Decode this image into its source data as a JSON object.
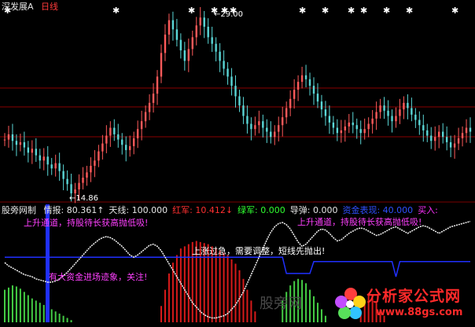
{
  "window": {
    "stock_name": "深发展A",
    "period": "日线"
  },
  "indicator": {
    "name": "股旁网制",
    "items": [
      {
        "label": "情报:",
        "value": "80.361↑",
        "color": "#e6e6e6"
      },
      {
        "label": "天线:",
        "value": "100.000",
        "color": "#e6e6e6"
      },
      {
        "label": "红军:",
        "value": "10.412↓",
        "color": "#ff3030"
      },
      {
        "label": "绿军:",
        "value": "0.000",
        "color": "#30ff30"
      },
      {
        "label": "导弹:",
        "value": "0.000",
        "color": "#e6e6e6"
      },
      {
        "label": "资金表现:",
        "value": "40.000",
        "color": "#3050ff"
      },
      {
        "label": "买入:",
        "value": "",
        "color": "#ff30ff"
      }
    ]
  },
  "annotations": {
    "high_price": "29.00",
    "low_price": "14.86",
    "text_uptrend_left": "上升通道，持股待长获高抛低吸!",
    "text_uptrend_right": "上升通道，持股待长获高抛低吸!",
    "text_overheat": "上涨过急，需要调整，短线先抛出!",
    "text_capital_in": "有大资金进场迹象，关注!"
  },
  "watermark": {
    "site_name": "分析家公式网",
    "site_url": "www.88gs.com",
    "faint_text": "股旁网"
  },
  "colors": {
    "bg": "#000000",
    "up_candle": "#ff5a5a",
    "down_candle": "#5ad7d7",
    "red_bars": "#d81a1a",
    "green_bars": "#44cc44",
    "white_line": "#f5f5f5",
    "blue_line": "#2030ff",
    "grid": "#8a0000"
  },
  "chart_data": [
    {
      "type": "line",
      "description_series": "price",
      "x": [
        0,
        1,
        2,
        3,
        4,
        5,
        6,
        7,
        8,
        9,
        10,
        11,
        12,
        13,
        14,
        15,
        16,
        17,
        18,
        19,
        20,
        21,
        22,
        23,
        24,
        25,
        26,
        27,
        28,
        29,
        30,
        31,
        32,
        33,
        34,
        35,
        36,
        37,
        38,
        39,
        40,
        41,
        42,
        43,
        44,
        45,
        46,
        47,
        48,
        49,
        50,
        51,
        52,
        53,
        54,
        55,
        56,
        57,
        58,
        59,
        60,
        61,
        62,
        63,
        64,
        65,
        66,
        67,
        68,
        69,
        70,
        71,
        72,
        73,
        74,
        75,
        76,
        77,
        78,
        79,
        80,
        81,
        82,
        83,
        84,
        85,
        86,
        87,
        88,
        89,
        90,
        91,
        92,
        93,
        94,
        95,
        96,
        97,
        98,
        99,
        100,
        101,
        102,
        103,
        104,
        105,
        106,
        107,
        108,
        109,
        110,
        111,
        112,
        113,
        114,
        115,
        116,
        117,
        118,
        119
      ],
      "series": [
        {
          "close": [
            19.2,
            19.6,
            19.1,
            18.8,
            19.0,
            18.6,
            18.2,
            18.5,
            18.0,
            17.6,
            17.9,
            17.3,
            17.0,
            17.4,
            16.8,
            16.2,
            15.8,
            15.1,
            15.4,
            15.9,
            16.3,
            16.7,
            17.2,
            17.6,
            18.3,
            18.9,
            19.5,
            20.1,
            19.6,
            19.2,
            18.8,
            18.4,
            18.7,
            19.3,
            20.0,
            20.6,
            21.3,
            22.0,
            22.7,
            24.0,
            25.8,
            27.2,
            28.3,
            27.6,
            26.8,
            26.0,
            25.2,
            26.1,
            27.0,
            27.9,
            28.5,
            27.8,
            27.0,
            26.5,
            25.9,
            25.2,
            24.6,
            24.0,
            23.3,
            22.5,
            21.8,
            21.0,
            20.4,
            20.0,
            20.3,
            20.6,
            20.1,
            19.8,
            19.4,
            19.8,
            20.3,
            20.9,
            21.6,
            22.3,
            23.0,
            23.6,
            24.1,
            23.8,
            23.3,
            22.7,
            22.1,
            21.5,
            21.0,
            20.5,
            20.1,
            19.7,
            19.9,
            20.2,
            20.5,
            20.3,
            20.0,
            19.7,
            20.0,
            20.4,
            20.8,
            21.3,
            21.8,
            21.4,
            21.0,
            20.6,
            21.0,
            21.5,
            22.0,
            21.6,
            21.1,
            20.7,
            20.3,
            19.9,
            19.5,
            19.1,
            19.4,
            19.8,
            19.4,
            19.0,
            18.6,
            18.9,
            19.3,
            19.7,
            20.1,
            19.8
          ]
        }
      ]
    },
    {
      "type": "area",
      "description_series": "indicator",
      "white_line": [
        55,
        52,
        50,
        48,
        46,
        44,
        43,
        42,
        40,
        39,
        38,
        37,
        37,
        38,
        40,
        43,
        46,
        50,
        54,
        58,
        62,
        66,
        70,
        73,
        76,
        78,
        79,
        78,
        76,
        73,
        70,
        66,
        62,
        60,
        62,
        65,
        68,
        71,
        72,
        70,
        66,
        60,
        54,
        48,
        42,
        36,
        30,
        24,
        18,
        14,
        10,
        7,
        5,
        4,
        4,
        5,
        6,
        8,
        12,
        16,
        22,
        28,
        36,
        44,
        52,
        60,
        68,
        76,
        83,
        88,
        91,
        92,
        90,
        86,
        80,
        74,
        70,
        72,
        76,
        80,
        84,
        86,
        85,
        82,
        78,
        75,
        76,
        79,
        82,
        84,
        86,
        87,
        86,
        84,
        82,
        80,
        81,
        83,
        85,
        87,
        88,
        86,
        84,
        82,
        84,
        86,
        88,
        89,
        88,
        86,
        84,
        82,
        84,
        86,
        88,
        89,
        90,
        91,
        92,
        93
      ],
      "red_bars": [
        0,
        0,
        0,
        0,
        0,
        0,
        0,
        0,
        0,
        0,
        0,
        0,
        0,
        0,
        0,
        0,
        0,
        0,
        0,
        0,
        0,
        0,
        0,
        0,
        0,
        0,
        0,
        0,
        0,
        0,
        0,
        0,
        0,
        0,
        0,
        0,
        0,
        0,
        0,
        0,
        15,
        30,
        45,
        55,
        62,
        68,
        70,
        72,
        74,
        75,
        74,
        73,
        72,
        70,
        68,
        66,
        64,
        62,
        58,
        54,
        48,
        40,
        30,
        20,
        10,
        0,
        0,
        0,
        0,
        0,
        0,
        0,
        0,
        0,
        0,
        0,
        0,
        0,
        0,
        0,
        0,
        0,
        0,
        0,
        0,
        0,
        0,
        0,
        0,
        0,
        0,
        10,
        20,
        25,
        22,
        18,
        12,
        6,
        0,
        0,
        0,
        0,
        0,
        0,
        0,
        0,
        0,
        0,
        0,
        0,
        0,
        0,
        0,
        0,
        0,
        0,
        0,
        0,
        0,
        0
      ],
      "green_bars": [
        30,
        32,
        34,
        33,
        31,
        28,
        25,
        22,
        20,
        18,
        16,
        14,
        12,
        10,
        8,
        6,
        4,
        2,
        0,
        0,
        0,
        0,
        0,
        0,
        0,
        0,
        0,
        0,
        0,
        0,
        0,
        0,
        0,
        0,
        0,
        0,
        0,
        0,
        0,
        0,
        0,
        0,
        0,
        0,
        0,
        0,
        0,
        0,
        0,
        0,
        0,
        0,
        0,
        0,
        0,
        0,
        0,
        0,
        0,
        0,
        0,
        0,
        0,
        0,
        0,
        0,
        0,
        0,
        0,
        0,
        0,
        20,
        28,
        34,
        38,
        40,
        39,
        36,
        30,
        24,
        18,
        12,
        6,
        0,
        0,
        0,
        0,
        0,
        0,
        0,
        0,
        0,
        0,
        0,
        0,
        0,
        0,
        0,
        0,
        0,
        0,
        0,
        0,
        0,
        0,
        0,
        0,
        0,
        0,
        0,
        0,
        0,
        0,
        0,
        0,
        0,
        0,
        0,
        0,
        0
      ],
      "ylim": [
        0,
        100
      ]
    }
  ]
}
